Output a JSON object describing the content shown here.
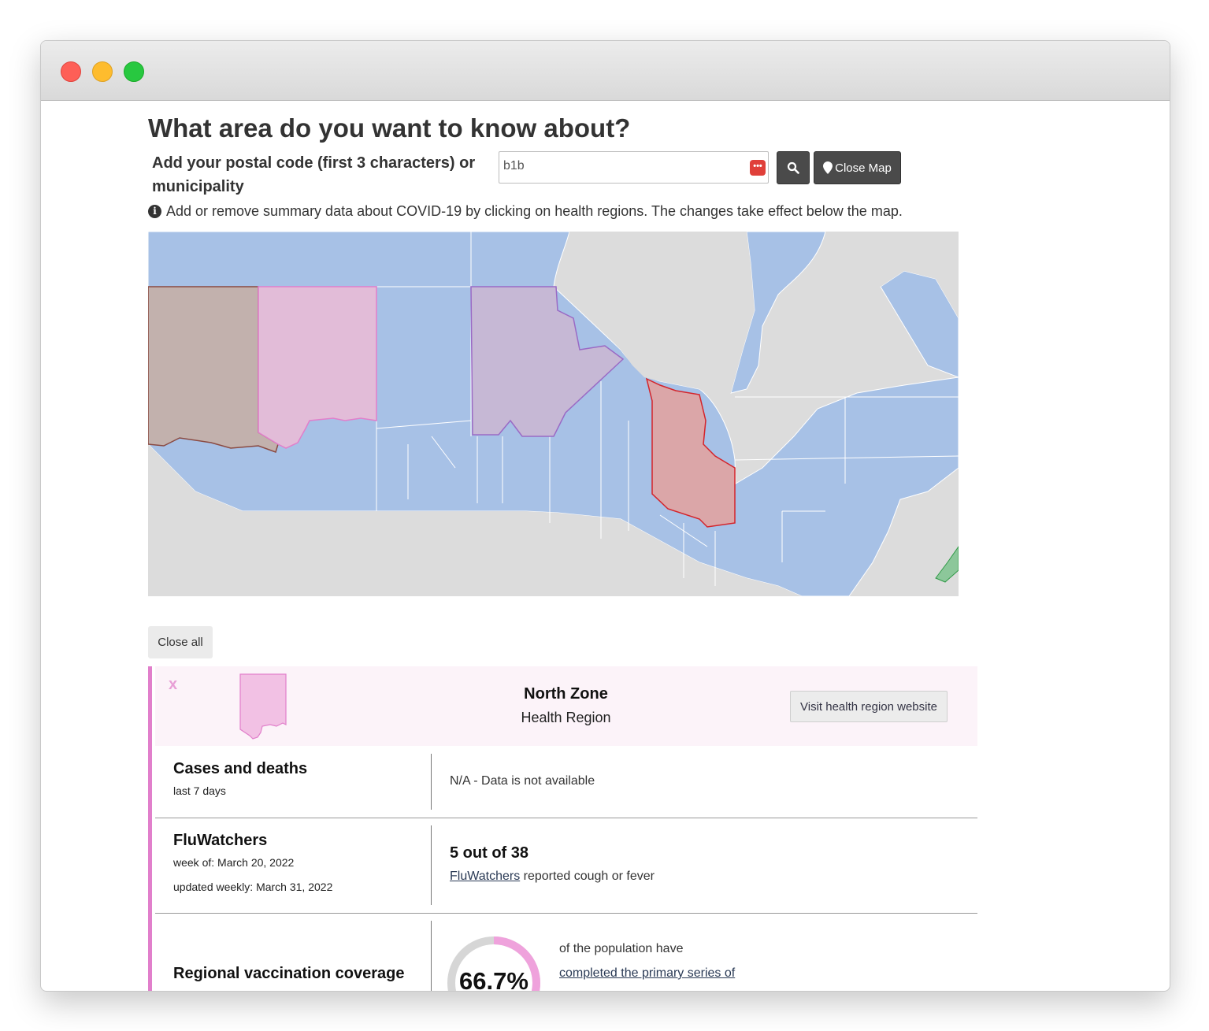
{
  "page": {
    "heading": "What area do you want to know about?",
    "postal_label_line1": "Add your postal code (first 3 characters) or",
    "postal_label_line2": "municipality",
    "search": {
      "value": "b1b",
      "search_icon": "search-icon",
      "password_manager_icon": "password-manager-icon"
    },
    "close_map_button": {
      "label": "Close Map",
      "icon": "map-marker-icon"
    },
    "info_text": "Add or remove summary data about COVID-19 by clicking on health regions. The changes take effect below the map."
  },
  "map": {
    "colors": {
      "land": "#a7c1e6",
      "water": "#dcdcdc",
      "region_brown": "#c2b1ad",
      "region_pink": "#e2bcd8",
      "region_purple": "#c6b8d5",
      "region_red": "#dba6a8"
    }
  },
  "close_all": "Close all",
  "card": {
    "close_label": "x",
    "region_name": "North Zone",
    "region_type": "Health Region",
    "visit_button": "Visit health region website",
    "accent_color": "#e17fcb",
    "rows": {
      "cases": {
        "title": "Cases and deaths",
        "sub": "last 7 days",
        "value": "N/A - Data is not available"
      },
      "flu": {
        "title": "FluWatchers",
        "sub1": "week of: March 20, 2022",
        "sub2": "updated weekly: March 31, 2022",
        "value": "5 out of 38",
        "link": "FluWatchers",
        "value_suffix": " reported cough or fever"
      },
      "vaccination": {
        "title": "Regional vaccination coverage",
        "percent_label": "66.7%",
        "fraction": 0.667,
        "text1": "of the population have",
        "link": "completed the primary series of"
      }
    }
  }
}
